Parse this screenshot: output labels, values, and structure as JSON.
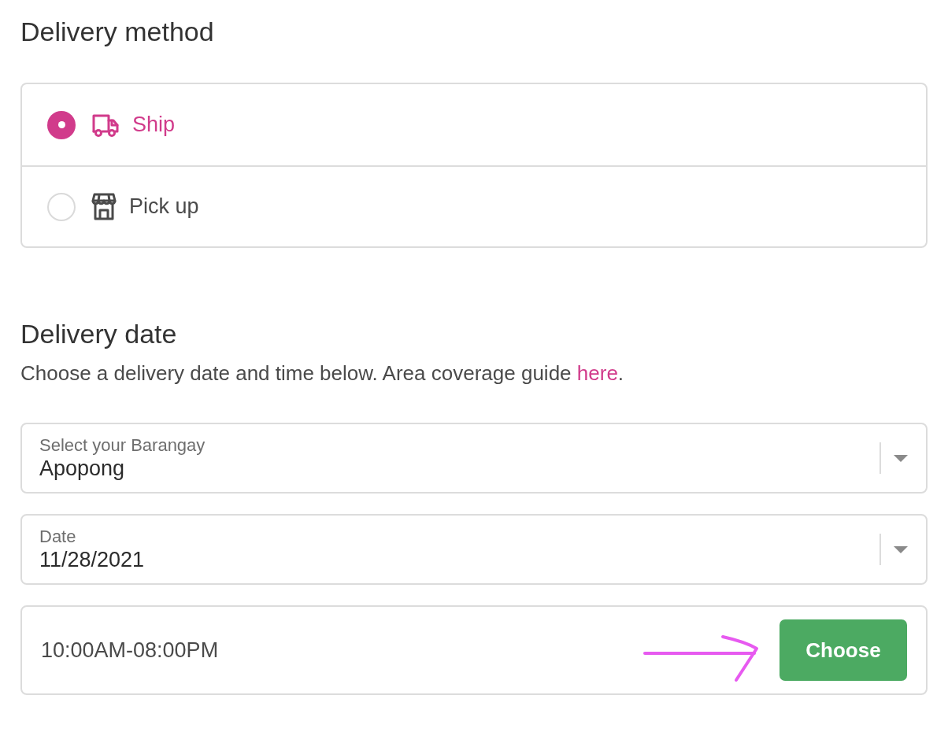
{
  "delivery_method": {
    "title": "Delivery method",
    "options": [
      {
        "kind": "ship",
        "label": "Ship",
        "selected": true
      },
      {
        "kind": "pickup",
        "label": "Pick up",
        "selected": false
      }
    ]
  },
  "delivery_date": {
    "title": "Delivery date",
    "description": "Choose a delivery date and time below. Area coverage guide ",
    "link": "here",
    "description_end": ".",
    "fields": [
      {
        "label": "Select your Barangay",
        "value": "Apopong"
      },
      {
        "label": "Date",
        "value": "11/28/2021"
      }
    ],
    "time_slot": {
      "time": "10:00AM-08:00PM",
      "button": "Choose"
    }
  }
}
